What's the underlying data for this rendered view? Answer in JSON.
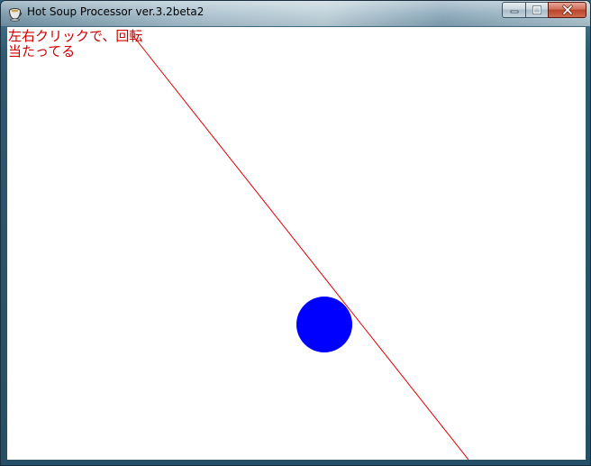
{
  "window": {
    "title": "Hot Soup Processor ver.3.2beta2"
  },
  "icons": {
    "app": "hsp-cup-icon",
    "minimize": "minimize-icon",
    "maximize": "maximize-icon",
    "close": "close-icon"
  },
  "canvas": {
    "text_color": "#cc0000",
    "line_color": "#dd0000",
    "circle_color": "#0000ff",
    "instruction": "左右クリックで、回転",
    "status": "当たってる"
  }
}
